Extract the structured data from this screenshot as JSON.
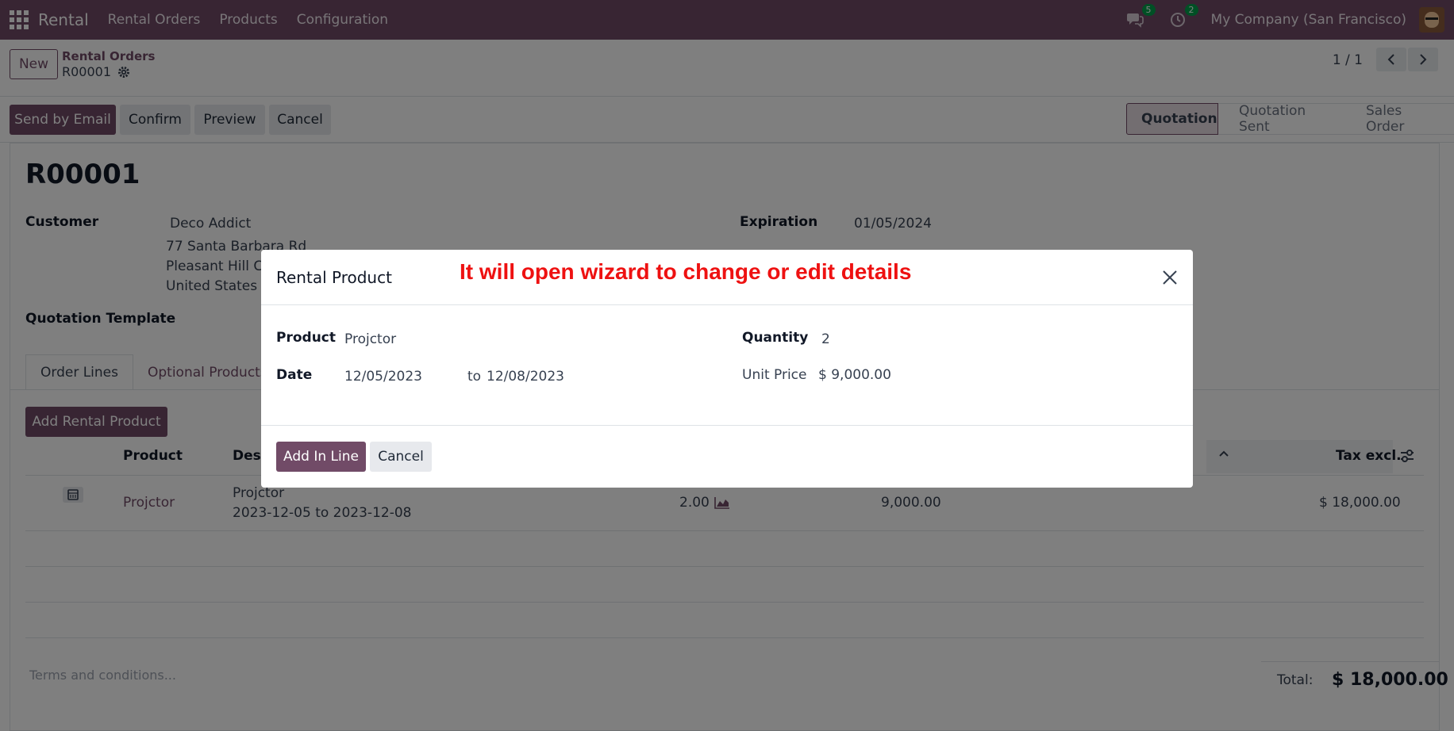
{
  "navbar": {
    "app_name": "Rental",
    "menu": [
      "Rental Orders",
      "Products",
      "Configuration"
    ],
    "messages_count": "5",
    "activities_count": "2",
    "company": "My Company (San Francisco)"
  },
  "control_panel": {
    "new_label": "New",
    "breadcrumb_parent": "Rental Orders",
    "breadcrumb_current": "R00001",
    "pager": "1 / 1"
  },
  "actions": {
    "send_email": "Send by Email",
    "confirm": "Confirm",
    "preview": "Preview",
    "cancel": "Cancel"
  },
  "statusbar": [
    "Quotation",
    "Quotation Sent",
    "Sales Order"
  ],
  "record": {
    "title": "R00001",
    "customer_label": "Customer",
    "customer_name": "Deco Addict",
    "address_line1": "77 Santa Barbara Rd",
    "address_line2": "Pleasant Hill CA",
    "address_line3": "United States –",
    "expiration_label": "Expiration",
    "expiration_value": "01/05/2024",
    "template_label": "Quotation Template"
  },
  "tabs": [
    "Order Lines",
    "Optional Products"
  ],
  "order_lines": {
    "add_button": "Add Rental Product",
    "headers": {
      "product": "Product",
      "description": "Desc",
      "tax_excl": "Tax excl."
    },
    "row": {
      "product": "Projctor",
      "description_line1": "Projctor",
      "description_line2": "2023-12-05 to 2023-12-08",
      "quantity": "2.00",
      "unit_price": "9,000.00",
      "subtotal": "$ 18,000.00"
    }
  },
  "footer": {
    "terms_placeholder": "Terms and conditions...",
    "total_label": "Total:",
    "total_value": "$ 18,000.00"
  },
  "modal": {
    "title": "Rental Product",
    "annotation": "It will open wizard to change or edit details",
    "product_label": "Product",
    "product_value": "Projctor",
    "date_label": "Date",
    "date_from": "12/05/2023",
    "date_to_label": "to",
    "date_to": "12/08/2023",
    "quantity_label": "Quantity",
    "quantity_value": "2",
    "unit_price_label": "Unit Price",
    "unit_price_value": "$ 9,000.00",
    "add_in_line": "Add In Line",
    "cancel": "Cancel"
  },
  "colors": {
    "brand": "#714B67",
    "annotation": "#ee1111"
  }
}
